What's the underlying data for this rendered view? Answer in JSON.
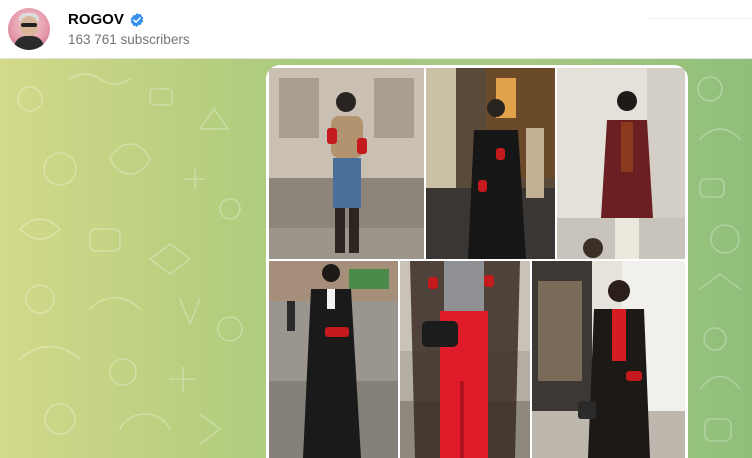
{
  "channel": {
    "name": "ROGOV",
    "subscribers": "163 761 subscribers",
    "avatar_icon": "profile-photo",
    "verified_icon": "verified-badge-icon",
    "verified_color": "#3390ec"
  },
  "post": {
    "photos": [
      {
        "id": "photo-1",
        "alt": "woman in camel sweater, red gloves, jeans, black boots"
      },
      {
        "id": "photo-2",
        "alt": "woman in black coat with red gloves on street"
      },
      {
        "id": "photo-3",
        "alt": "woman in burgundy leather jacket, white trousers"
      },
      {
        "id": "photo-4",
        "alt": "woman in black leather trench coat with red gloves"
      },
      {
        "id": "photo-5",
        "alt": "woman in red trousers and grey top with handbag"
      },
      {
        "id": "photo-6",
        "alt": "woman in black coat with red turtleneck"
      }
    ]
  },
  "colors": {
    "accent": "#3390ec",
    "subscriber_text": "#707579",
    "chat_bg_left": "#d3d98a",
    "chat_bg_right": "#8fbf7b"
  }
}
